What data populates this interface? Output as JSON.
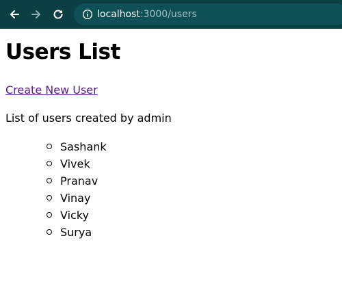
{
  "browser": {
    "url_host": "localhost",
    "url_path": ":3000/users",
    "icons": {
      "back": "arrow-left-icon",
      "forward": "arrow-right-icon",
      "reload": "reload-icon",
      "site_info": "info-icon"
    }
  },
  "page": {
    "title": "Users List",
    "create_link": "Create New User",
    "description": "List of users created by admin",
    "users": [
      "Sashank",
      "Vivek",
      "Pranav",
      "Vinay",
      "Vicky",
      "Surya"
    ]
  },
  "colors": {
    "toolbar": "#0b3f44",
    "omnibox": "#0f5057",
    "link": "#551a8b"
  }
}
